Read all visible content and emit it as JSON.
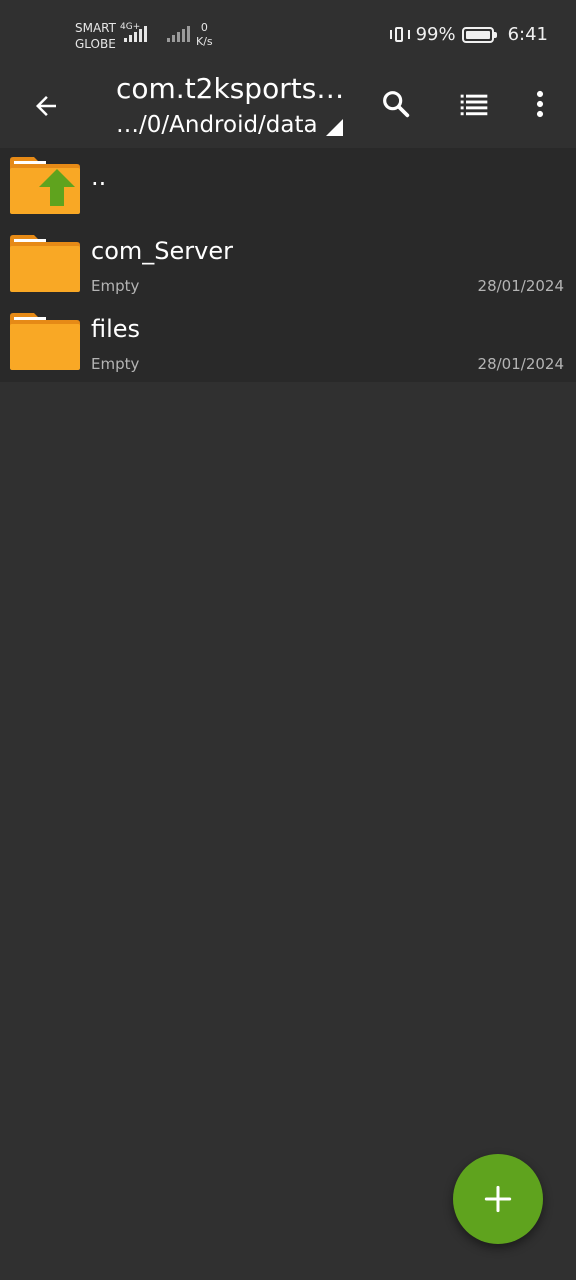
{
  "status_bar": {
    "carrier_line1": "SMART",
    "carrier_line2": "GLOBE",
    "network": "4G+",
    "speed_value": "0",
    "speed_unit": "K/s",
    "battery": "99%",
    "battery_level": 0.99,
    "time": "6:41"
  },
  "toolbar": {
    "title": "com.t2ksports…",
    "path": "…/0/Android/data"
  },
  "icons": {
    "back": "arrow-left-icon",
    "search": "search-icon",
    "view": "list-view-icon",
    "more": "more-vert-icon",
    "add": "plus-icon",
    "parent": "folder-up-icon",
    "folder": "folder-icon"
  },
  "colors": {
    "background": "#303030",
    "list_background": "#292929",
    "folder": "#f9a825",
    "folder_tab": "#e68a16",
    "up_arrow": "#5fa31e",
    "fab": "#5fa31e"
  },
  "list": {
    "parent": {
      "name": ".."
    },
    "items": [
      {
        "name": "com_Server",
        "sub": "Empty",
        "date": "28/01/2024"
      },
      {
        "name": "files",
        "sub": "Empty",
        "date": "28/01/2024"
      }
    ]
  }
}
